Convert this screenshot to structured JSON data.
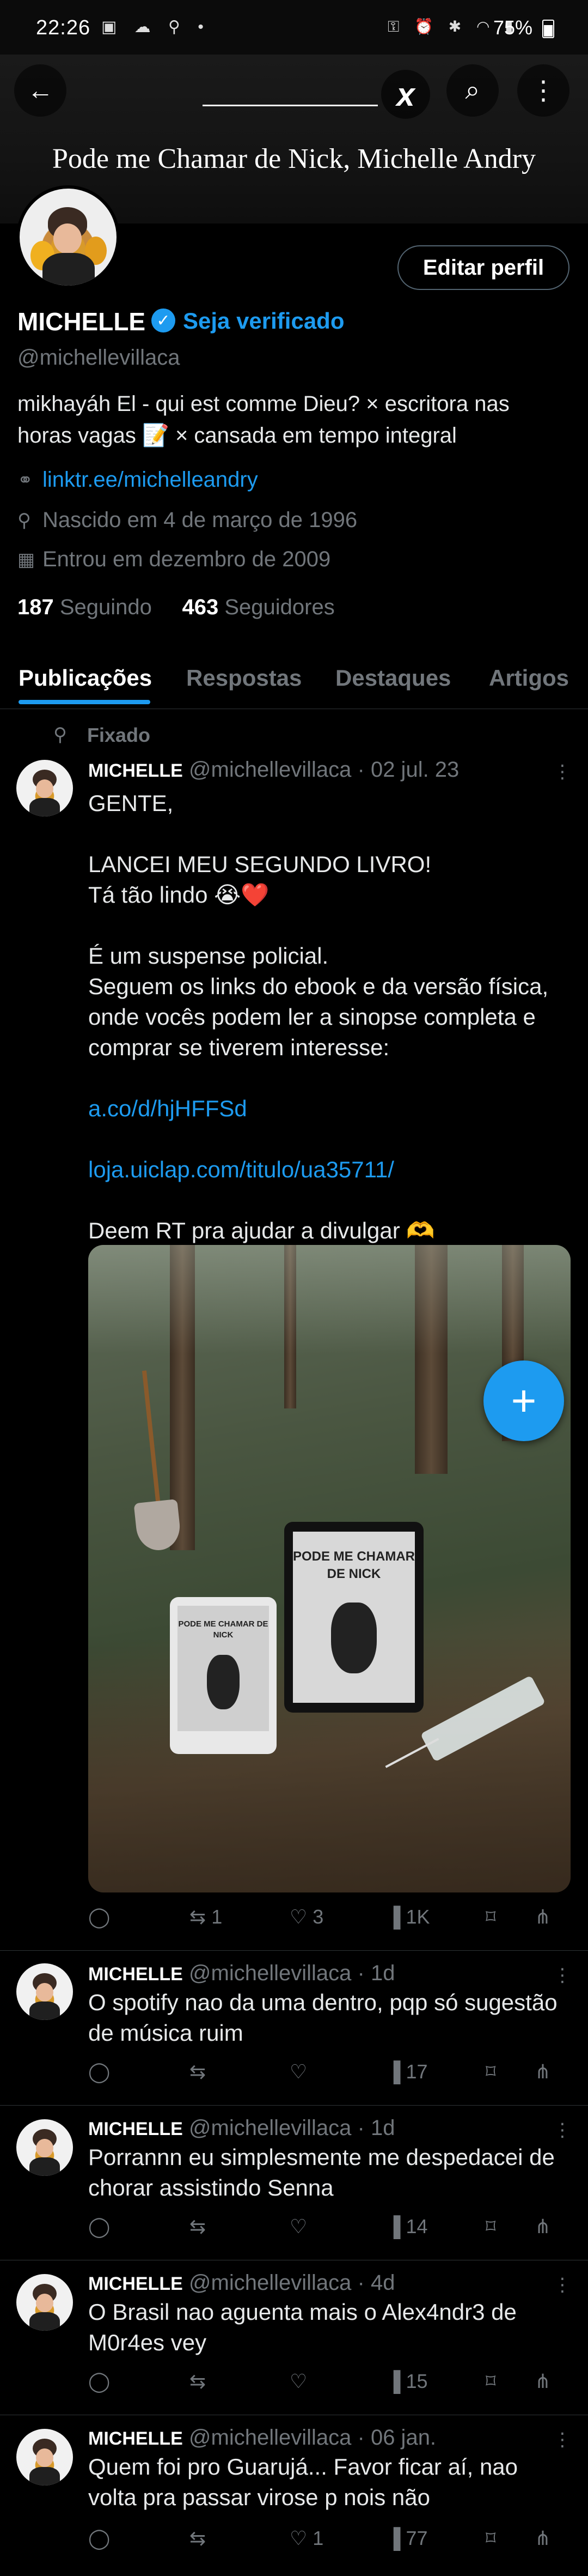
{
  "status_bar": {
    "time": "22:26",
    "left_icons": "▣ ☁ ⚲ •",
    "right_icons": "⚿ ⏰ ✱ ◠ ▮",
    "battery": "75%"
  },
  "banner": {
    "title": "Pode me Chamar de Nick, Michelle Andry",
    "ai_glyph": "x"
  },
  "profile": {
    "edit_button": "Editar perfil",
    "name": "MICHELLE",
    "verify_link": "Seja verificado",
    "handle": "@michellevillaca",
    "bio_line1": "mikhayáh El - qui est comme Dieu?  × escritora nas",
    "bio_line2": "horas vagas 📝 × cansada em tempo integral",
    "website": "linktr.ee/michelleandry",
    "birth": "Nascido em 4 de março de 1996",
    "joined": "Entrou em dezembro de 2009",
    "following_count": "187",
    "following_label": "Seguindo",
    "followers_count": "463",
    "followers_label": "Seguidores"
  },
  "tabs": [
    "Publicações",
    "Respostas",
    "Destaques",
    "Artigos"
  ],
  "pinned_label": "Fixado",
  "pinned_tweet": {
    "name": "MICHELLE",
    "handle": "@michellevillaca",
    "date": "· 02 jul. 23",
    "lines": [
      "GENTE,",
      "",
      "LANCEI MEU SEGUNDO LIVRO!",
      "Tá tão lindo 😭❤️",
      "",
      "É um suspense policial.",
      "Seguem os links do ebook e da versão física,",
      "onde vocês podem ler a sinopse completa e",
      "comprar se tiverem interesse:",
      "",
      "a.co/d/hjHFFSd",
      "",
      "loja.uiclap.com/titulo/ua35711/",
      "",
      "Deem RT pra ajudar a divulgar 🫶"
    ],
    "book_cover_large": "PODE ME CHAMAR DE NICK",
    "book_cover_small": "PODE ME CHAMAR DE NICK",
    "retweets": "1",
    "likes": "3",
    "views": "1K"
  },
  "tweets": [
    {
      "name": "MICHELLE",
      "handle": "@michellevillaca",
      "date": "· 1d",
      "line1": "O spotify nao da uma dentro, pqp só sugestão",
      "line2": "de música ruim",
      "retweets": "",
      "likes": "",
      "views": "17"
    },
    {
      "name": "MICHELLE",
      "handle": "@michellevillaca",
      "date": "· 1d",
      "line1": "Porrannn eu simplesmente me despedacei de",
      "line2": "chorar assistindo Senna",
      "retweets": "",
      "likes": "",
      "views": "14"
    },
    {
      "name": "MICHELLE",
      "handle": "@michellevillaca",
      "date": "· 4d",
      "line1": "O Brasil nao aguenta mais o Alex4ndr3 de",
      "line2": "M0r4es vey",
      "retweets": "",
      "likes": "",
      "views": "15"
    },
    {
      "name": "MICHELLE",
      "handle": "@michellevillaca",
      "date": "· 06 jan.",
      "line1": "Quem foi pro Guarujá... Favor ficar aí, nao",
      "line2": "volta pra passar virose p nois não",
      "retweets": "",
      "likes": "1",
      "views": "77"
    }
  ],
  "icons": {
    "reply": "◯",
    "retweet": "⇆",
    "like": "♡",
    "views": "▐",
    "bookmark": "⌑",
    "share": "⋔",
    "more": "⋮",
    "fab_plus": "+",
    "back": "←",
    "search": "⌕",
    "link": "🔗",
    "balloon": "◌",
    "calendar": "▦",
    "pin": "📌"
  },
  "colors": {
    "accent": "#1d9bf0",
    "muted": "#71767b",
    "text": "#e7e9ea",
    "separator": "#2f3336"
  }
}
